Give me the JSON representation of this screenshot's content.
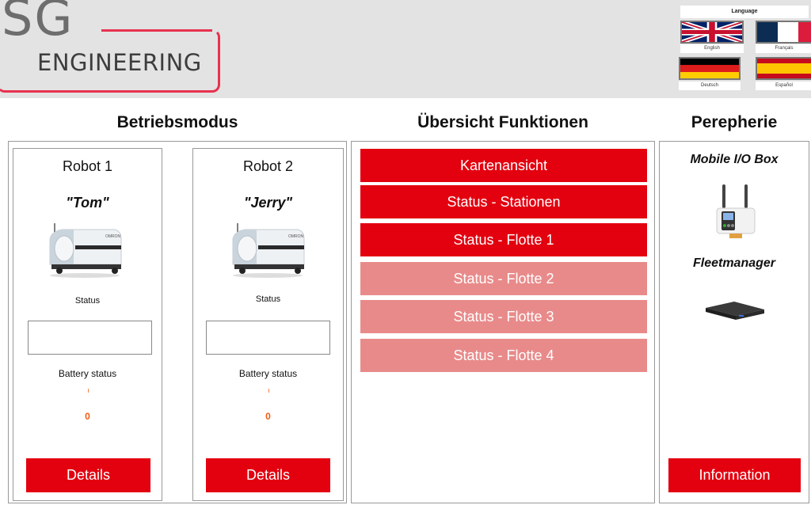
{
  "header": {
    "logo": {
      "line1": "SG",
      "line2": "ENGINEERING"
    },
    "language": {
      "title": "Language",
      "options": [
        {
          "label": "English",
          "flag": "uk-flag-icon"
        },
        {
          "label": "Français",
          "flag": "france-flag-icon"
        },
        {
          "label": "Deutsch",
          "flag": "germany-flag-icon"
        },
        {
          "label": "Español",
          "flag": "spain-flag-icon"
        }
      ]
    }
  },
  "sections": {
    "betriebsmodus": {
      "title": "Betriebsmodus",
      "robots": [
        {
          "name": "Robot 1",
          "nickname": "\"Tom\"",
          "status_label": "Status",
          "status_value": "",
          "battery_label": "Battery status",
          "battery_value": "0",
          "button": "Details"
        },
        {
          "name": "Robot 2",
          "nickname": "\"Jerry\"",
          "status_label": "Status",
          "status_value": "",
          "battery_label": "Battery status",
          "battery_value": "0",
          "button": "Details"
        }
      ]
    },
    "funktionen": {
      "title": "Übersicht Funktionen",
      "buttons": [
        {
          "label": "Kartenansicht",
          "enabled": true
        },
        {
          "label": "Status - Stationen",
          "enabled": true
        },
        {
          "label": "Status - Flotte 1",
          "enabled": true
        },
        {
          "label": "Status - Flotte 2",
          "enabled": false
        },
        {
          "label": "Status - Flotte 3",
          "enabled": false
        },
        {
          "label": "Status - Flotte 4",
          "enabled": false
        }
      ]
    },
    "perepherie": {
      "title": "Perepherie",
      "items": [
        {
          "label": "Mobile I/O Box"
        },
        {
          "label": "Fleetmanager"
        }
      ],
      "button": "Information"
    }
  },
  "colors": {
    "accent": "#e3000f",
    "disabled": "#e98a8a",
    "logo_red": "#e8314f",
    "battery": "#f05a14"
  }
}
